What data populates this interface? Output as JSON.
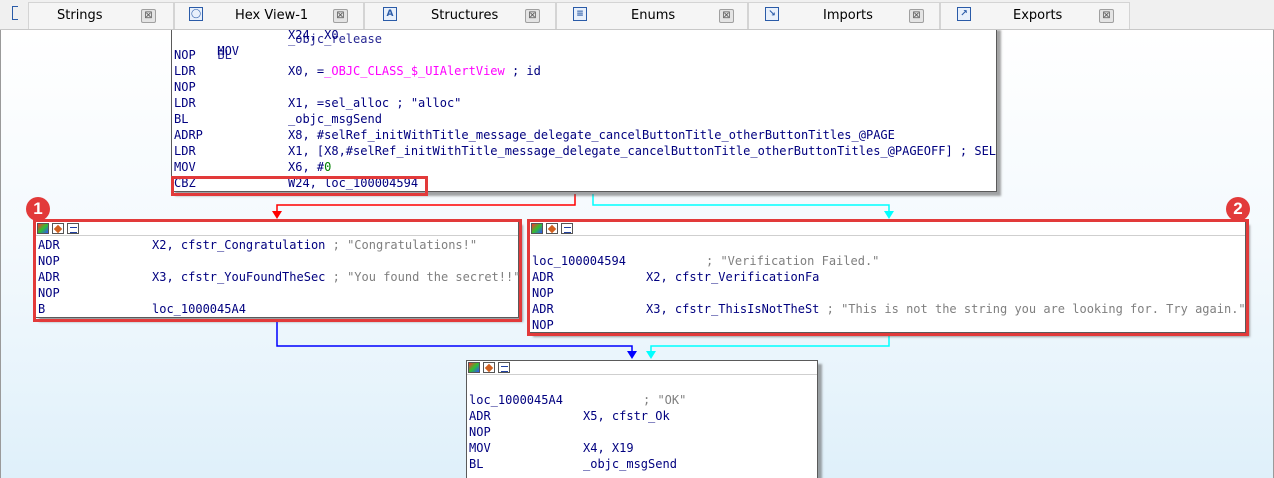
{
  "tabs": [
    {
      "label": "Strings",
      "icon": "strings-icon"
    },
    {
      "label": "Hex View-1",
      "icon": "hex-view-icon"
    },
    {
      "label": "Structures",
      "icon": "structures-icon"
    },
    {
      "label": "Enums",
      "icon": "enums-icon"
    },
    {
      "label": "Imports",
      "icon": "imports-icon"
    },
    {
      "label": "Exports",
      "icon": "exports-icon"
    }
  ],
  "tab_close_glyph": "⊠",
  "annotations": {
    "badge1": "1",
    "badge2": "2",
    "highlight_color": "#e23a3a"
  },
  "edge_colors": {
    "false_branch": "#ff0000",
    "true_branch": "#00ffff",
    "jump": "#0000ff"
  },
  "top_block": {
    "lines": [
      {
        "mn": "MOV",
        "op": "X24, X0",
        "overlap": "_objc_release",
        "overlap_mn": "BL"
      },
      {
        "mn": "NOP",
        "op": ""
      },
      {
        "mn": "LDR",
        "op": "X0, =",
        "sym": "_OBJC_CLASS_$_UIAlertView",
        "tail": " ; id"
      },
      {
        "mn": "NOP",
        "op": ""
      },
      {
        "mn": "LDR",
        "op": "X1, =sel_alloc ; \"alloc\""
      },
      {
        "mn": "BL",
        "op": "_objc_msgSend"
      },
      {
        "mn": "ADRP",
        "op": "X8, #selRef_initWithTitle_message_delegate_cancelButtonTitle_otherButtonTitles_@PAGE"
      },
      {
        "mn": "LDR",
        "op": "X1, [X8,#selRef_initWithTitle_message_delegate_cancelButtonTitle_otherButtonTitles_@PAGEOFF] ; SEL"
      },
      {
        "mn": "MOV",
        "op": "X6, #",
        "num": "0"
      },
      {
        "mn": "CBZ",
        "op": "W24, loc_100004594"
      }
    ]
  },
  "left_block": {
    "lines": [
      {
        "mn": "ADR",
        "op": "X2, cfstr_Congratulation",
        "cmt": " ; \"Congratulations!\""
      },
      {
        "mn": "NOP",
        "op": ""
      },
      {
        "mn": "ADR",
        "op": "X3, cfstr_YouFoundTheSec",
        "cmt": " ; \"You found the secret!!\""
      },
      {
        "mn": "NOP",
        "op": ""
      },
      {
        "mn": "B",
        "op": "loc_1000045A4"
      }
    ]
  },
  "right_block": {
    "label": "loc_100004594",
    "label_cmt": "; \"Verification Failed.\"",
    "lines": [
      {
        "mn": "ADR",
        "op": "X2, cfstr_VerificationFa",
        "cmt": ""
      },
      {
        "mn": "NOP",
        "op": ""
      },
      {
        "mn": "ADR",
        "op": "X3, cfstr_ThisIsNotTheSt",
        "cmt": " ; \"This is not the string you are looking for. Try again.\""
      },
      {
        "mn": "NOP",
        "op": ""
      }
    ]
  },
  "bottom_block": {
    "label": "loc_1000045A4",
    "label_cmt": "; \"OK\"",
    "lines": [
      {
        "mn": "ADR",
        "op": "X5, cfstr_Ok"
      },
      {
        "mn": "NOP",
        "op": ""
      },
      {
        "mn": "MOV",
        "op": "X4, X19"
      },
      {
        "mn": "BL",
        "op": "_objc_msgSend"
      }
    ]
  }
}
